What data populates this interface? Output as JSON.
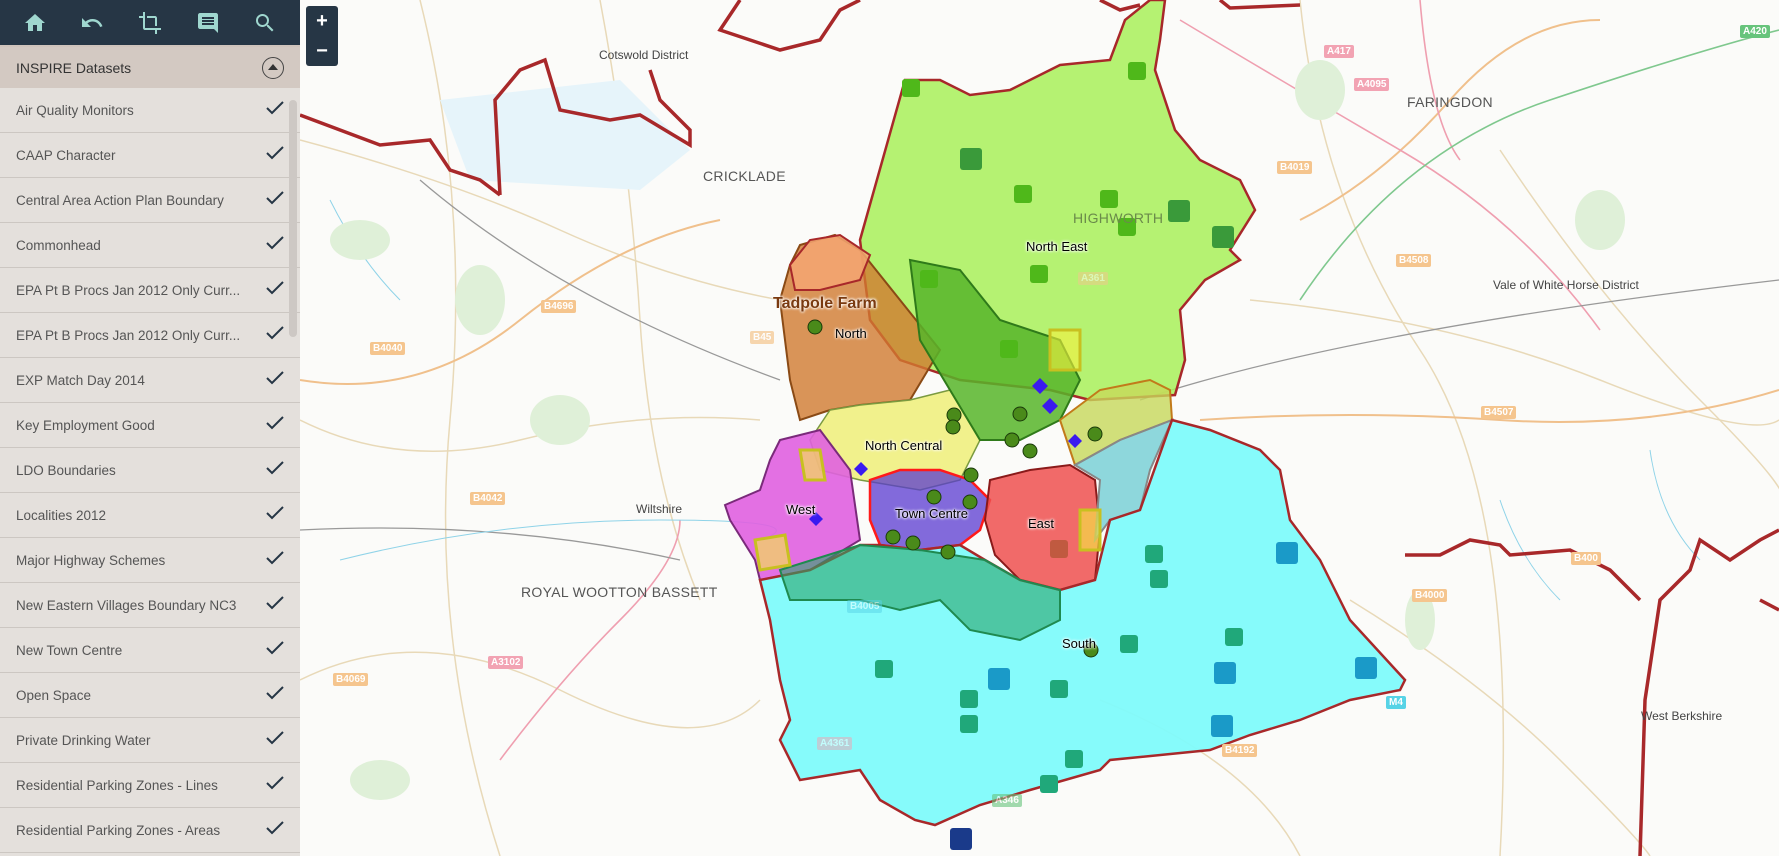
{
  "toolbar": {
    "icons": [
      "home-icon",
      "undo-icon",
      "crop-icon",
      "comment-icon",
      "search-icon"
    ]
  },
  "panel": {
    "title": "INSPIRE Datasets",
    "layers": [
      {
        "label": "Air Quality Monitors",
        "checked": true
      },
      {
        "label": "CAAP Character",
        "checked": true
      },
      {
        "label": "Central Area Action Plan Boundary",
        "checked": true
      },
      {
        "label": "Commonhead",
        "checked": true
      },
      {
        "label": "EPA Pt B Procs Jan 2012 Only Curr...",
        "checked": true
      },
      {
        "label": "EPA Pt B Procs Jan 2012 Only Curr...",
        "checked": true
      },
      {
        "label": "EXP Match Day 2014",
        "checked": true
      },
      {
        "label": "Key Employment Good",
        "checked": true
      },
      {
        "label": "LDO Boundaries",
        "checked": true
      },
      {
        "label": "Localities 2012",
        "checked": true
      },
      {
        "label": "Major Highway Schemes",
        "checked": true
      },
      {
        "label": "New Eastern Villages Boundary NC3",
        "checked": true
      },
      {
        "label": "New Town Centre",
        "checked": true
      },
      {
        "label": "Open Space",
        "checked": true
      },
      {
        "label": "Private Drinking Water",
        "checked": true
      },
      {
        "label": "Residential Parking Zones - Lines",
        "checked": true
      },
      {
        "label": "Residential Parking Zones - Areas",
        "checked": true
      }
    ]
  },
  "zoom": {
    "in": "+",
    "out": "−"
  },
  "map": {
    "places": {
      "cotswold": "Cotswold District",
      "cricklade": "CRICKLADE",
      "faringdon": "FARINGDON",
      "vale": "Vale of White Horse District",
      "wiltshire": "Wiltshire",
      "wootton": "ROYAL WOOTTON BASSETT",
      "west_berkshire": "West Berkshire",
      "highworth": "HIGHWORTH"
    },
    "roads": {
      "a417": "A417",
      "a4095": "A4095",
      "a420": "A420",
      "b4019": "B4019",
      "b4508": "B4508",
      "b4507": "B4507",
      "b4696": "B4696",
      "b4040": "B4040",
      "b4042": "B4042",
      "b4069": "B4069",
      "a3102": "A3102",
      "b4000": "B4000",
      "b4000b": "B400",
      "b4192": "B4192",
      "m4": "M4",
      "a346": "A346",
      "a361": "A361",
      "b4005": "B4005",
      "a4361": "A4361",
      "b45": "B45"
    },
    "areas": {
      "tadpole": "Tadpole Farm",
      "north": "North",
      "north_east": "North East",
      "north_central": "North Central",
      "west": "West",
      "town_centre": "Town Centre",
      "east": "East",
      "south": "South"
    },
    "colors": {
      "district_boundary": "#a8282a",
      "north_east": "#a8f05a",
      "north": "#e08a4a",
      "north_central": "#f0ef80",
      "west": "#e060e0",
      "east": "#ee6060",
      "south": "#80fbfb",
      "open_space": "#2aa56a"
    }
  }
}
